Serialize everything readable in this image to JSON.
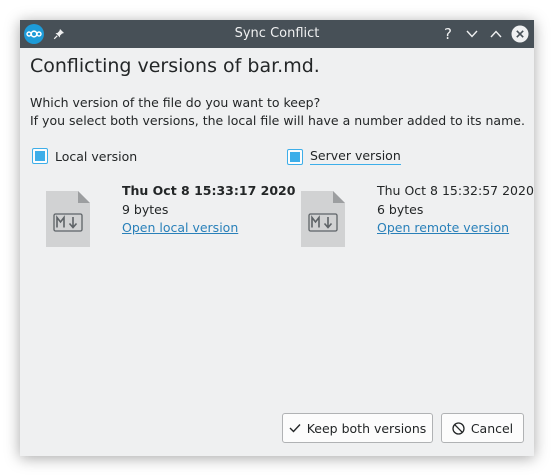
{
  "window": {
    "title": "Sync Conflict",
    "controls": [
      "help-icon",
      "minimize-icon",
      "maximize-icon",
      "close-icon"
    ]
  },
  "main": {
    "heading": "Conflicting versions of bar.md.",
    "question": "Which version of the file do you want to keep?",
    "hint": "If you select both versions, the local file will have a number added to its name."
  },
  "local": {
    "checkbox_label": "Local version",
    "checked": true,
    "date": "Thu Oct 8 15:33:17 2020",
    "size": "9 bytes",
    "link": "Open local version",
    "icon": "markdown-file-icon"
  },
  "server": {
    "checkbox_label": "Server version",
    "checked": true,
    "date": "Thu Oct 8 15:32:57 2020",
    "size": "6 bytes",
    "link": "Open remote version",
    "icon": "markdown-file-icon"
  },
  "buttons": {
    "keep_both": "Keep both versions",
    "cancel": "Cancel"
  },
  "colors": {
    "titlebar": "#475057",
    "accent": "#3daee9",
    "link": "#2980b9",
    "window_bg": "#eff0f1"
  }
}
